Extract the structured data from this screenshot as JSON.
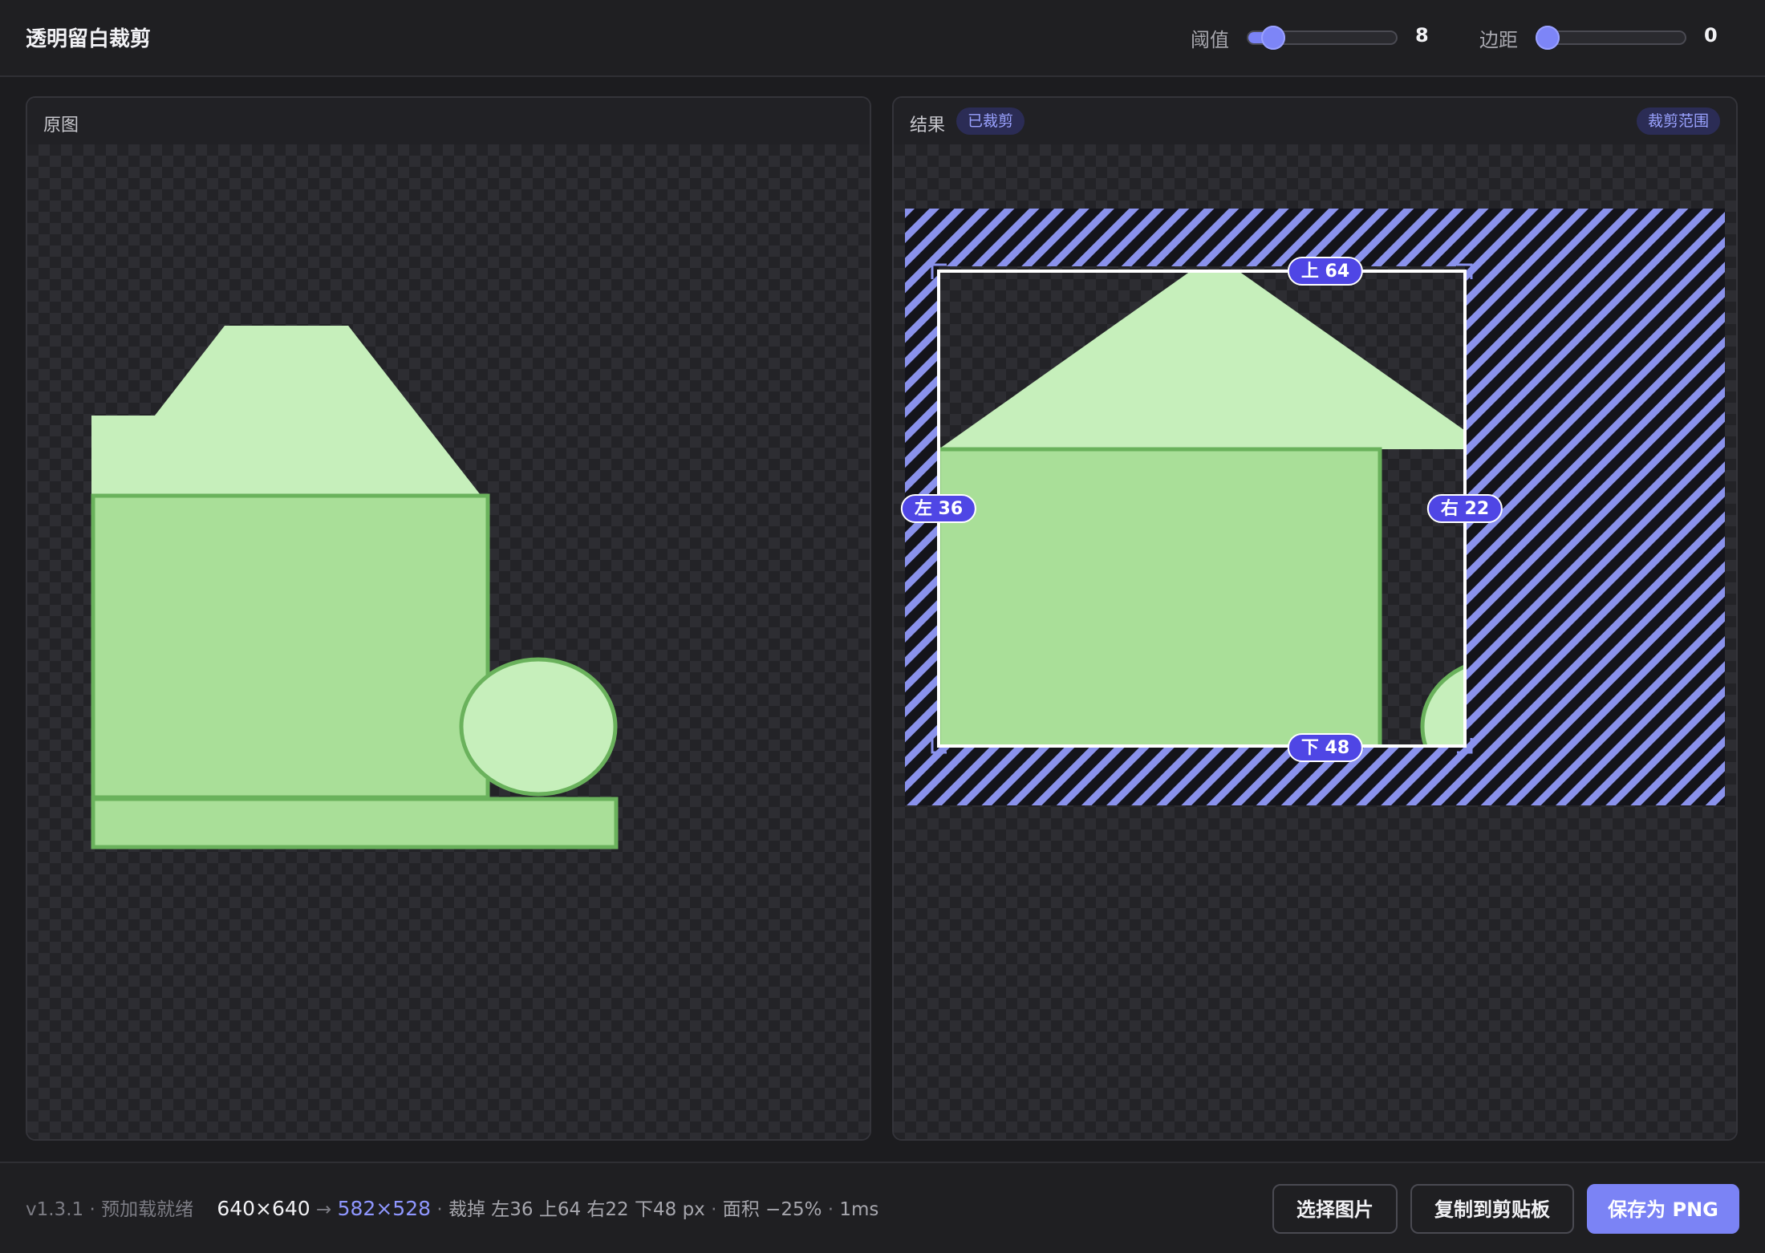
{
  "app": {
    "title": "透明留白裁剪"
  },
  "controls": {
    "threshold": {
      "label": "阈值",
      "value": "8",
      "level": 0.1
    },
    "padding": {
      "label": "边距",
      "value": "0",
      "level": 0.0
    }
  },
  "panels": {
    "original": {
      "title": "原图"
    },
    "result": {
      "title": "结果",
      "status_badge": "已裁剪",
      "range_badge": "裁剪范围"
    }
  },
  "crop_markers": {
    "top": "上 64",
    "left": "左 36",
    "right": "右 22",
    "bottom": "下 48"
  },
  "footer": {
    "version": "v1.3.1 · 预加载就绪",
    "original_size": "640×640",
    "arrow": "→",
    "new_size": "582×528",
    "sep1": "·",
    "crop_info": "裁掉 左36 上64 右22 下48 px",
    "sep2": "·",
    "area": "面积 −25%",
    "sep3": "·",
    "time": "1ms",
    "buttons": {
      "choose": "选择图片",
      "copy": "复制到剪贴板",
      "save": "保存为 PNG"
    }
  },
  "colors": {
    "accent": "#7b83f5",
    "shape_fill": "#a9df98",
    "shape_light": "#c6efbb",
    "shape_stroke": "#6ab25c",
    "badge_bg": "#4f46e5"
  }
}
